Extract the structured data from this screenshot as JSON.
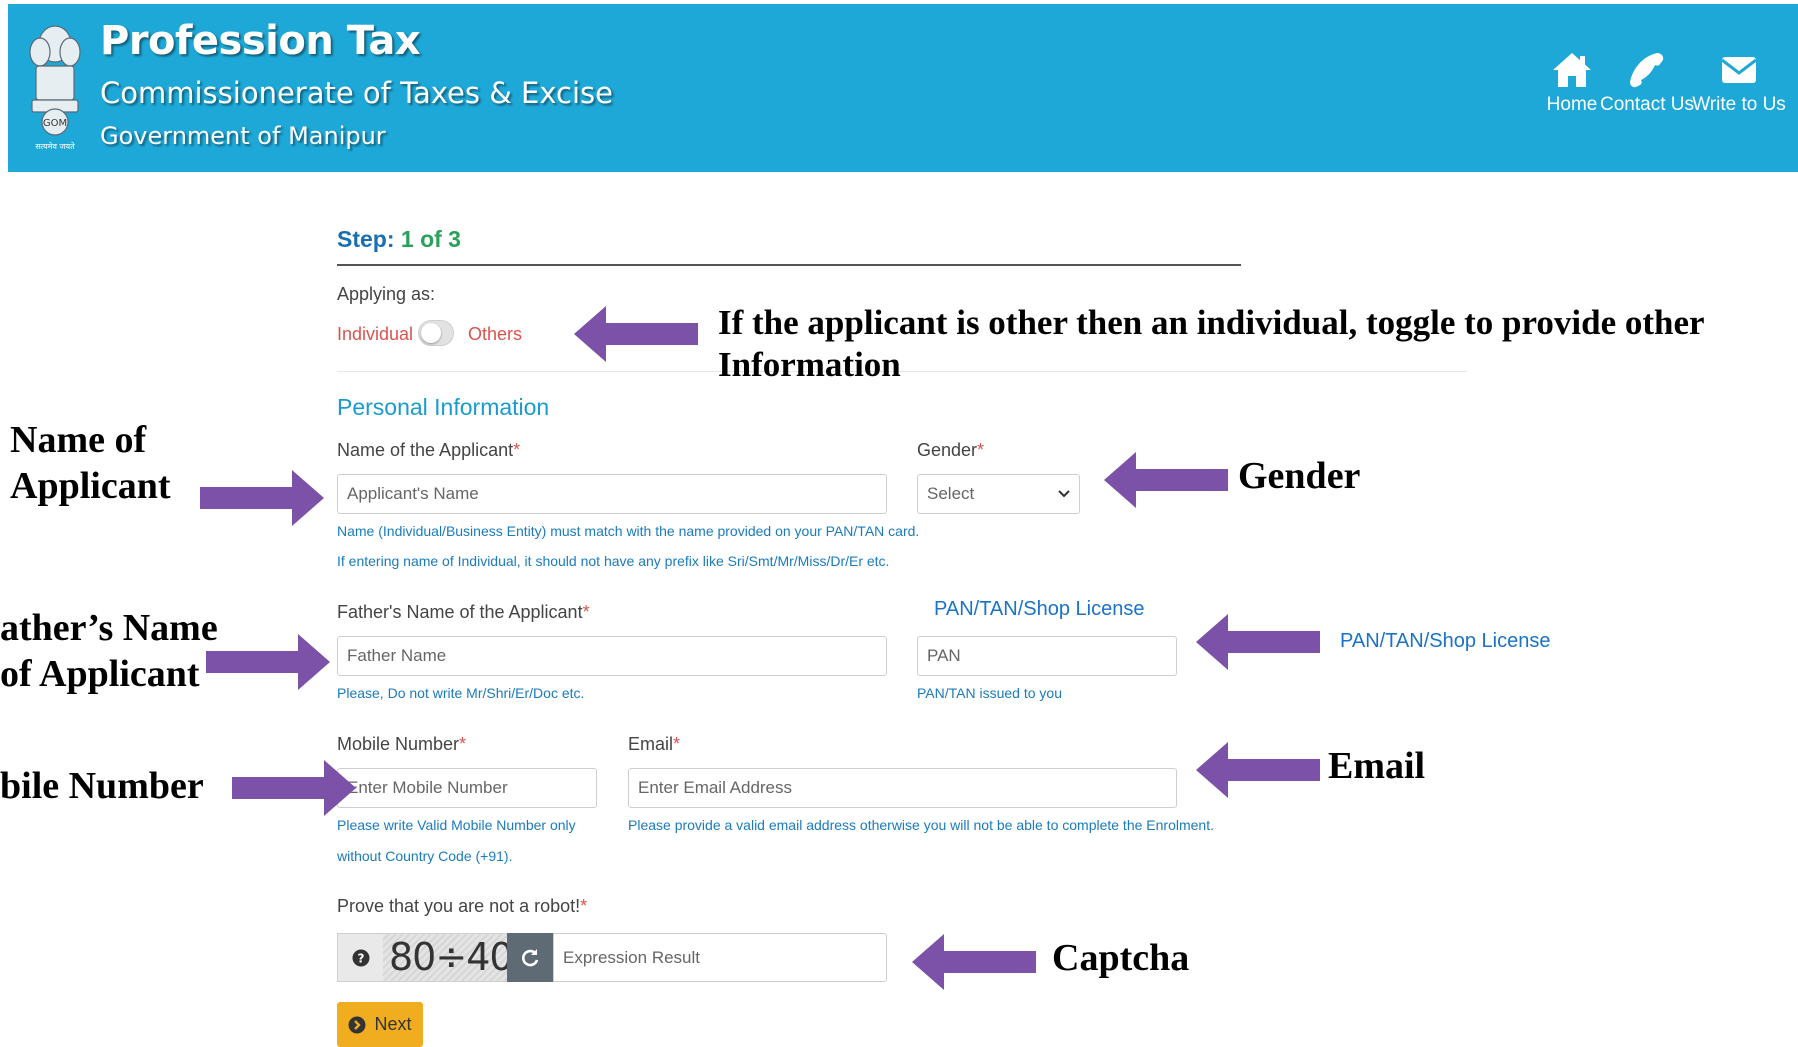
{
  "header": {
    "title": "Profession Tax",
    "subtitle": "Commissionerate of Taxes & Excise",
    "government": "Government of Manipur",
    "nav": [
      {
        "label": "Home",
        "icon": "home-icon"
      },
      {
        "label": "Contact Us",
        "icon": "phone-icon"
      },
      {
        "label": "Write to Us",
        "icon": "envelope-icon"
      }
    ]
  },
  "form": {
    "step_label": "Step:",
    "step_value": "1 of 3",
    "applying_as": "Applying as:",
    "toggle_left": "Individual",
    "toggle_right": "Others",
    "section_title": "Personal Information",
    "name_label": "Name of the Applicant",
    "name_placeholder": "Applicant's Name",
    "name_hint_1": "Name (Individual/Business Entity) must match with the name provided on your PAN/TAN card.",
    "name_hint_2": "If entering name of Individual, it should not have any prefix like Sri/Smt/Mr/Miss/Dr/Er etc.",
    "gender_label": "Gender",
    "gender_value": "Select",
    "father_label": "Father's Name of the Applicant",
    "father_placeholder": "Father Name",
    "father_hint": "Please, Do not write Mr/Shri/Er/Doc etc.",
    "pan_link": "PAN/TAN/Shop License",
    "pan_placeholder": "PAN",
    "pan_hint": "PAN/TAN issued to you",
    "mobile_label": "Mobile Number",
    "mobile_placeholder": "Enter Mobile Number",
    "mobile_hint_1": "Please write Valid Mobile Number only",
    "mobile_hint_2": "without Country Code (+91).",
    "email_label": "Email",
    "email_placeholder": "Enter Email Address",
    "email_hint": "Please provide a valid email address otherwise you will not be able to complete the Enrolment.",
    "robot_label": "Prove that you are not a robot!",
    "required_mark": "*",
    "captcha_expression": "80÷40=",
    "captcha_placeholder": "Expression Result",
    "next_label": "Next"
  },
  "annotations": {
    "toggle_note_1": "If the applicant is other then an individual, toggle to provide other",
    "toggle_note_2": "Information",
    "name_1": "Name of",
    "name_2": "Applicant",
    "gender": "Gender",
    "father_1": "ather’s Name",
    "father_2": "of Applicant",
    "pan": "PAN/TAN/Shop License",
    "mobile": "bile Number",
    "email": "Email",
    "captcha": "Captcha"
  },
  "colors": {
    "header_bg": "#1ea8d8",
    "arrow": "#7b52a8",
    "step_blue": "#1a6fb3",
    "step_green": "#2aa05a",
    "next_button": "#f0ad1f"
  }
}
